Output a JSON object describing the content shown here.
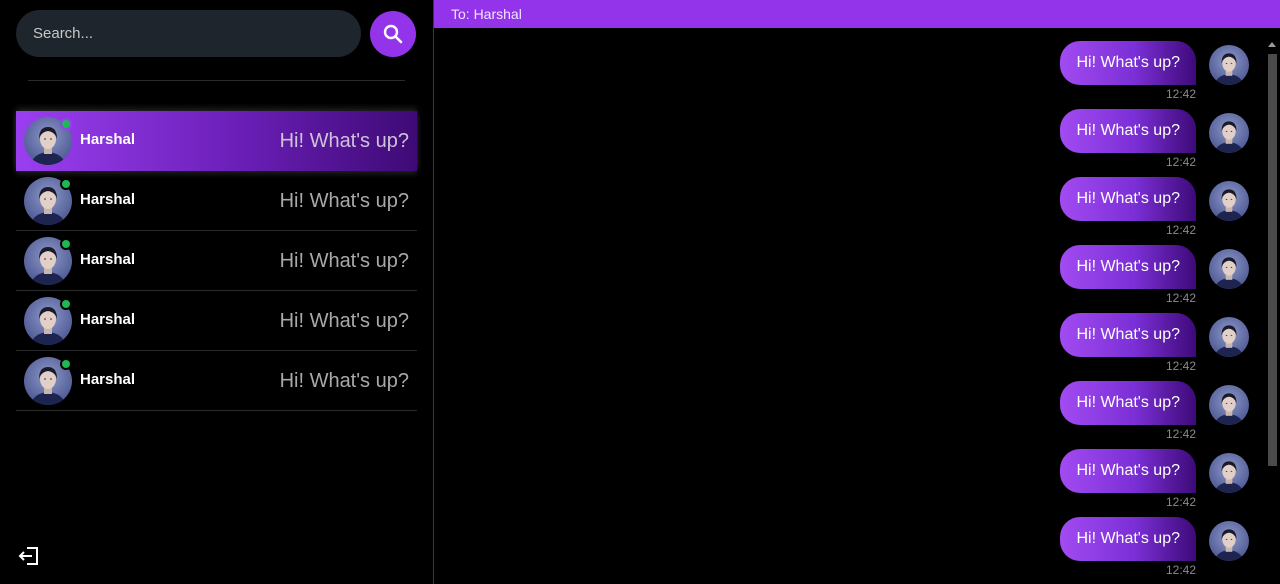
{
  "search": {
    "placeholder": "Search..."
  },
  "conversations": [
    {
      "name": "Harshal",
      "preview": "Hi! What's up?",
      "online": true,
      "active": true
    },
    {
      "name": "Harshal",
      "preview": "Hi! What's up?",
      "online": true,
      "active": false
    },
    {
      "name": "Harshal",
      "preview": "Hi! What's up?",
      "online": true,
      "active": false
    },
    {
      "name": "Harshal",
      "preview": "Hi! What's up?",
      "online": true,
      "active": false
    },
    {
      "name": "Harshal",
      "preview": "Hi! What's up?",
      "online": true,
      "active": false
    }
  ],
  "chat": {
    "header": "To: Harshal",
    "messages": [
      {
        "text": "Hi! What's up?",
        "time": "12:42"
      },
      {
        "text": "Hi! What's up?",
        "time": "12:42"
      },
      {
        "text": "Hi! What's up?",
        "time": "12:42"
      },
      {
        "text": "Hi! What's up?",
        "time": "12:42"
      },
      {
        "text": "Hi! What's up?",
        "time": "12:42"
      },
      {
        "text": "Hi! What's up?",
        "time": "12:42"
      },
      {
        "text": "Hi! What's up?",
        "time": "12:42"
      },
      {
        "text": "Hi! What's up?",
        "time": "12:42"
      }
    ]
  },
  "icons": {
    "search": "search-icon",
    "logout": "logout-icon",
    "online": "online-status-icon"
  },
  "colors": {
    "accent": "#9333ea",
    "online": "#1db954",
    "input_bg": "#1e252d",
    "background": "#000000"
  }
}
